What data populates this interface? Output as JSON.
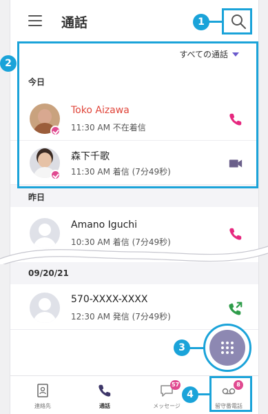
{
  "header": {
    "title": "通話"
  },
  "filter": {
    "label": "すべての通話"
  },
  "sections": {
    "today": "今日",
    "yesterday": "昨日",
    "date": "09/20/21"
  },
  "calls": [
    {
      "name": "Toko Aizawa",
      "meta": "11:30 AM 不在着信",
      "status": "missed",
      "action_icon": "phone-icon"
    },
    {
      "name": "森下千歌",
      "meta": "11:30 AM 着信 (7分49秒)",
      "status": "incoming",
      "action_icon": "video-icon"
    },
    {
      "name": "Amano Iguchi",
      "meta": "10:30 AM 着信 (7分49秒)",
      "status": "incoming",
      "action_icon": "phone-icon"
    },
    {
      "name": "570-XXXX-XXXX",
      "meta": "12:30 AM 発信 (7分49秒)",
      "status": "outgoing",
      "action_icon": "outgoing-call-icon"
    }
  ],
  "bottom_nav": [
    {
      "label": "連絡先",
      "icon": "contacts-icon"
    },
    {
      "label": "通話",
      "icon": "phone-icon",
      "active": true
    },
    {
      "label": "メッセージ",
      "icon": "message-icon",
      "badge": "57"
    },
    {
      "label": "留守番電話",
      "icon": "voicemail-icon",
      "badge": "8"
    }
  ],
  "annotations": [
    "1",
    "2",
    "3",
    "4"
  ],
  "colors": {
    "accent": "#1aa3d9",
    "missed": "#e0453a",
    "call": "#e6287f",
    "outgoing": "#2e9c4a",
    "fab": "#8d88b2"
  }
}
